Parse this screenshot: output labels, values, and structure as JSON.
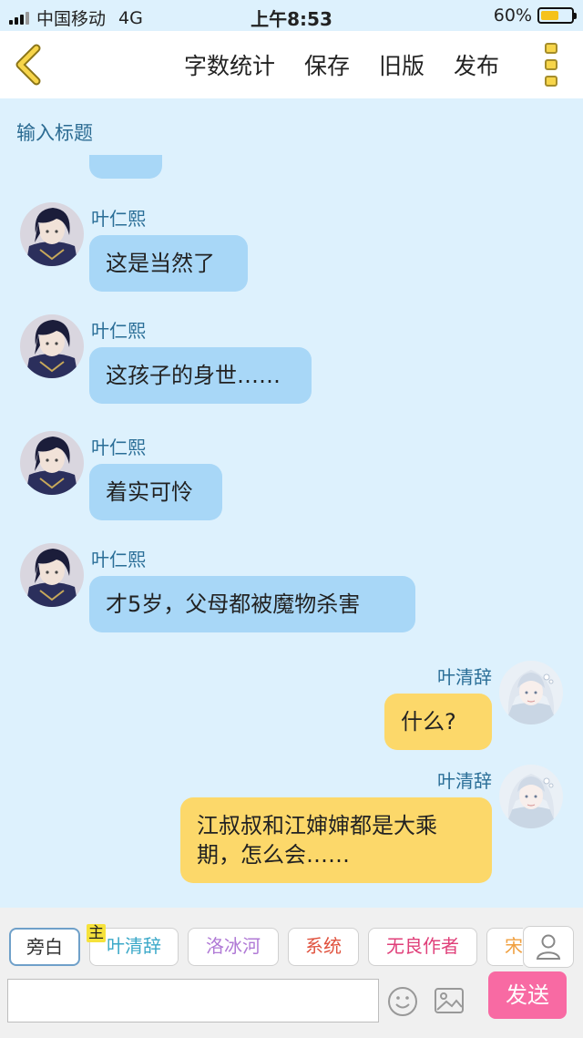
{
  "status_bar": {
    "carrier": "中国移动",
    "network": "4G",
    "time": "上午8:53",
    "battery_percent": "60%",
    "battery_level": 0.6
  },
  "nav": {
    "back_icon": "chevron-left-icon",
    "actions": [
      "字数统计",
      "保存",
      "旧版",
      "发布"
    ],
    "more_icon": "more-vertical-icon"
  },
  "title_placeholder": "输入标题",
  "messages": [
    {
      "speaker": "叶仁熙",
      "side": "left",
      "text": "这是当然了"
    },
    {
      "speaker": "叶仁熙",
      "side": "left",
      "text": "这孩子的身世……"
    },
    {
      "speaker": "叶仁熙",
      "side": "left",
      "text": "着实可怜"
    },
    {
      "speaker": "叶仁熙",
      "side": "left",
      "text": "才5岁，父母都被魔物杀害"
    },
    {
      "speaker": "叶清辞",
      "side": "right",
      "text": "什么?"
    },
    {
      "speaker": "叶清辞",
      "side": "right",
      "text": "江叔叔和江婶婶都是大乘期，怎么会……"
    }
  ],
  "roles": {
    "host_badge": "主",
    "items": [
      {
        "label": "旁白",
        "color": "#333333"
      },
      {
        "label": "叶清辞",
        "color": "#3aa8c8"
      },
      {
        "label": "洛冰河",
        "color": "#b07ad6"
      },
      {
        "label": "系统",
        "color": "#e0533f"
      },
      {
        "label": "无良作者",
        "color": "#e0407a"
      },
      {
        "label": "宋",
        "color": "#f0a040"
      }
    ]
  },
  "composer": {
    "user_icon": "user-icon",
    "emoji_icon": "smiley-icon",
    "image_icon": "image-icon",
    "send_label": "发送"
  },
  "colors": {
    "background": "#ddf1fd",
    "left_bubble": "#a8d7f7",
    "right_bubble": "#fcd86a",
    "name": "#2a6e97",
    "send_button": "#f86aa3"
  }
}
